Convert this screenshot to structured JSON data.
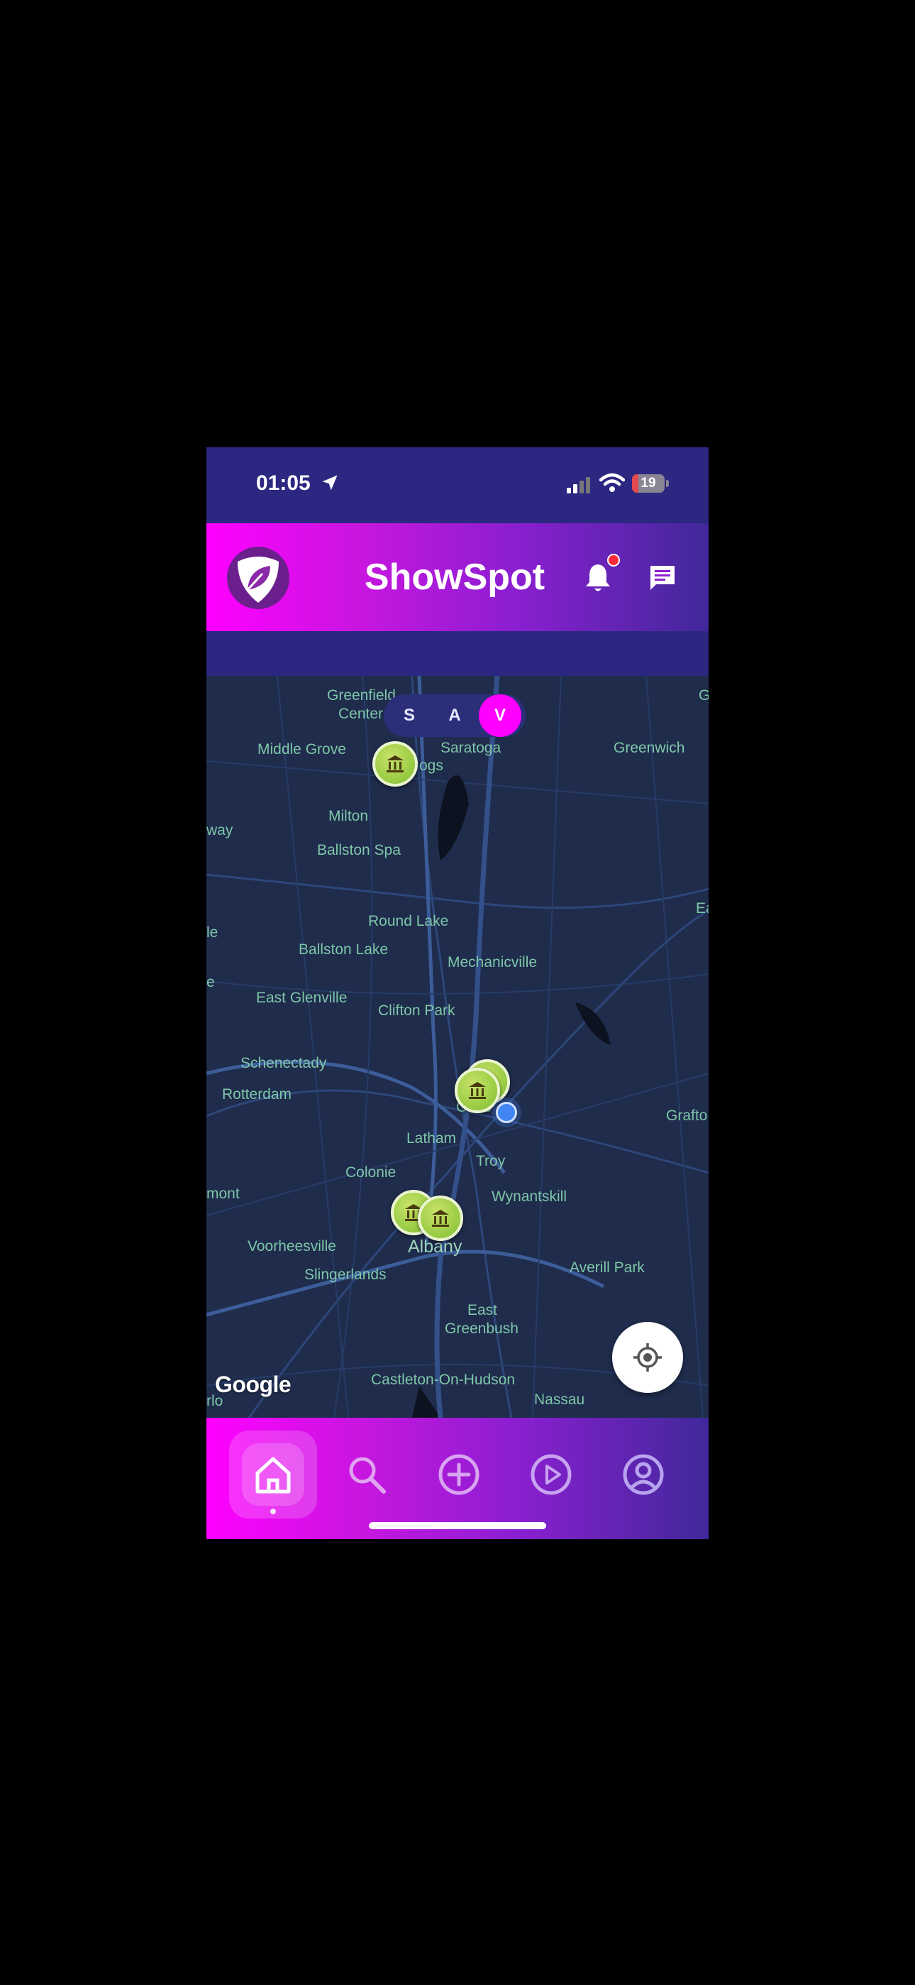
{
  "status_bar": {
    "time": "01:05",
    "battery_level": "19",
    "battery_fraction": 0.19,
    "icons": [
      "location-arrow-icon",
      "signal-icon",
      "wifi-icon",
      "battery-icon"
    ]
  },
  "header": {
    "title": "ShowSpot",
    "logo": "leaf-shield-logo",
    "notification_icon": "bell-icon",
    "messages_icon": "chat-icon",
    "has_unread_notification": true
  },
  "map": {
    "segments": [
      {
        "label": "S",
        "active": false
      },
      {
        "label": "A",
        "active": false
      },
      {
        "label": "V",
        "active": true
      }
    ],
    "places": [
      "Greenfield",
      "Center",
      "Middle Grove",
      "Saratoga",
      "ogs",
      "Greenwich",
      "G",
      "Milton",
      "way",
      "Ballston Spa",
      "Round Lake",
      "Ea",
      "le",
      "Ballston Lake",
      "Mechanicville",
      "e",
      "East Glenville",
      "Clifton Park",
      "Schenectady",
      "Rotterdam",
      "Coho",
      "Grafto",
      "Latham",
      "Troy",
      "Colonie",
      "mont",
      "Wynantskill",
      "Voorheesville",
      "Albany",
      "Slingerlands",
      "Averill Park",
      "East",
      "Greenbush",
      "Castleton-On-Hudson",
      "Nassau",
      "rlo"
    ],
    "venue_marker_icon": "museum-icon",
    "venue_marker_count": 5,
    "attribution": "Google",
    "recenter_icon": "crosshair-icon"
  },
  "tab_bar": {
    "tabs": [
      {
        "name": "home",
        "icon": "home-icon",
        "active": true
      },
      {
        "name": "search",
        "icon": "search-icon",
        "active": false
      },
      {
        "name": "create",
        "icon": "plus-circle-icon",
        "active": false
      },
      {
        "name": "play",
        "icon": "play-circle-icon",
        "active": false
      },
      {
        "name": "profile",
        "icon": "user-circle-icon",
        "active": false
      }
    ]
  },
  "colors": {
    "brand_magenta": "#ff00ff",
    "brand_indigo": "#2c2780",
    "map_background": "#1f2c4c",
    "map_label": "#7ec6a8",
    "marker_green": "#9acd32",
    "user_location": "#4285f4"
  }
}
